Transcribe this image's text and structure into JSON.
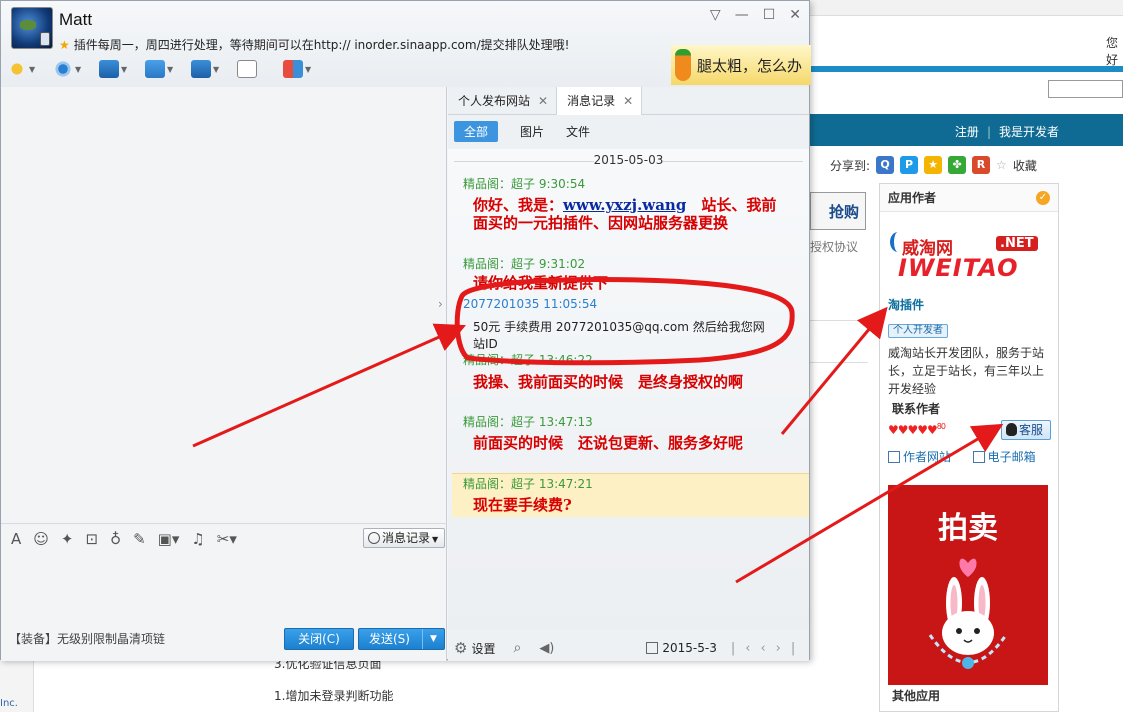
{
  "background_page": {
    "user_snippet": "您好",
    "nav_register": "注册",
    "nav_developer": "我是开发者",
    "share_label": "分享到:",
    "favorite": "收藏",
    "buy_button": "抢购",
    "agreement_text": "授权协议",
    "inc_text": "Inc.",
    "article_line1": "3.优化验证信息页面",
    "article_line2": "1.增加未登录判断功能",
    "sidebar": {
      "title": "应用作者",
      "logo_top": "威淘网",
      "logo_net": ".NET",
      "logo_main": "IWEITAO",
      "plugin_name": "淘插件",
      "dev_badge": "个人开发者",
      "dev_desc": "威淘站长开发团队，服务于站长，立足于站长，有三年以上开发经验",
      "contact_title": "联系作者",
      "hearts": "♥♥♥♥♥",
      "hearts_count": "80",
      "kefu": "客服",
      "author_site": "作者网站",
      "email": "电子邮箱",
      "auction_title": "拍卖",
      "other_apps": "其他应用"
    }
  },
  "chat_window": {
    "contact_name": "Matt",
    "status_text": "插件每周一，周四进行处理，等待期间可以在http:// inorder.sinaapp.com/提交排队处理哦!",
    "ad_text": "腿太粗，怎么办",
    "tabs": [
      {
        "label": "个人发布网站"
      },
      {
        "label": "消息记录"
      }
    ],
    "filters": [
      "全部",
      "图片",
      "文件"
    ],
    "date": "2015-05-03",
    "messages": [
      {
        "sender": "精品阁：超子",
        "time": "9:30:54",
        "pre": "你好、我是：",
        "link": "www.yxzj.wang",
        "post": "　站长、我前面买的一元拍插件、因网站服务器更换"
      },
      {
        "sender": "精品阁：超子",
        "time": "9:31:02",
        "text": "请你给我重新提供下"
      },
      {
        "sender": "2077201035",
        "time": "11:05:54",
        "text": "50元 手续费用 2077201035@qq.com 然后给我您网站ID"
      },
      {
        "sender": "精品阁：超子",
        "time": "13:46:22",
        "text": "我操、我前面买的时候　是终身授权的啊"
      },
      {
        "sender": "精品阁：超子",
        "time": "13:47:13",
        "text": "前面买的时候　还说包更新、服务多好呢"
      },
      {
        "sender": "精品阁：超子",
        "time": "13:47:21",
        "text": "现在要手续费?"
      }
    ],
    "history_button": "消息记录",
    "equip_text": "【装备】无级别限制晶清项链",
    "close_button": "关闭(C)",
    "send_button": "发送(S)",
    "settings_label": "设置",
    "bottom_date": "2015-5-3"
  }
}
